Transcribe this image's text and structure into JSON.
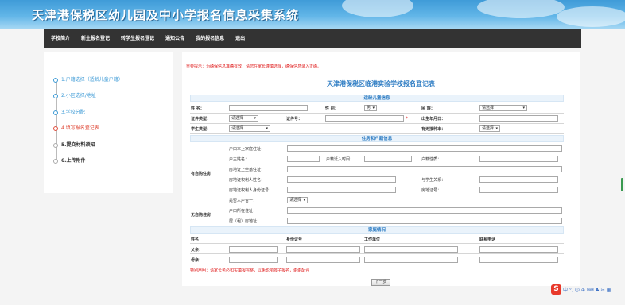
{
  "header": {
    "title": "天津港保税区幼儿园及中小学报名信息采集系统"
  },
  "nav": {
    "items": [
      "学校简介",
      "新生报名登记",
      "转学生报名登记",
      "通知公告",
      "我的报名信息",
      "退出"
    ]
  },
  "sidebar": {
    "steps": [
      {
        "label": "1.户籍选择（适龄儿童户籍）",
        "state": "done"
      },
      {
        "label": "2.小区选择/地址",
        "state": "done"
      },
      {
        "label": "3.学校分配",
        "state": "done"
      },
      {
        "label": "4.填写报名登记表",
        "state": "current"
      },
      {
        "label": "5.提交材料须知",
        "state": "todo"
      },
      {
        "label": "6.上传附件",
        "state": "todo"
      }
    ]
  },
  "main": {
    "notice": "重要提示：为确保信息准确有效，请您在家长谨慎选择，确保信息录入正确。",
    "form_title": "天津港保税区临港实验学校报名登记表",
    "sections": {
      "child": "适龄儿童信息",
      "residence": "住房和户籍信息",
      "family": "家庭情况"
    },
    "child": {
      "name_label": "姓 名：",
      "gender_label": "性 别：",
      "gender_value": "男",
      "ethnicity_label": "民 族：",
      "ethnicity_value": "请选择",
      "idtype_label": "证件类型：",
      "idtype_value": "请选择",
      "idno_label": "证件号：",
      "birth_label": "出生年月日：",
      "student_type_label": "学生类型：",
      "student_type_value": "请选择",
      "vaccine_label": "有无接种本：",
      "vaccine_value": "请选择"
    },
    "residence": {
      "group1": "有自购住房",
      "group2": "无自购住房",
      "hukou_addr": "户口本上家庭住址：",
      "head_name": "户主姓名：",
      "move_time": "户籍迁入时间：",
      "hukou_type": "户籍性质：",
      "deed_addr": "房地证上坐落住址：",
      "owner_name": "房地证权利人姓名：",
      "relation": "与学生关系：",
      "owner_id": "房地证权利人身份证号：",
      "deed_no": "房地证号：",
      "same_hukou": "是否人户合一：",
      "same_hukou_value": "请选择",
      "reg_addr": "户口所在住址：",
      "live_addr": "居（租）房地址："
    },
    "family": {
      "headers": [
        "姓名",
        "身份证号",
        "工作单位",
        "联系电话"
      ],
      "father": "父亲：",
      "mother": "母亲："
    },
    "footnote": "特别声明：请家长务必如实填报完整，以免影响孩子报名，谢谢配合",
    "next_button": "下一步"
  },
  "ime": {
    "logo": "S",
    "glyphs": "中 °, ☺ ⊕ ⌨ ♣ ✂ ▦"
  }
}
